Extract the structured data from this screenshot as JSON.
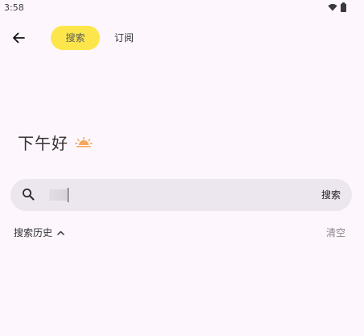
{
  "status_bar": {
    "time": "3:58",
    "icons": [
      "wifi-icon",
      "battery-icon"
    ]
  },
  "top_bar": {
    "back_icon": "arrow-back-icon",
    "tabs": [
      {
        "label": "搜索",
        "active": true
      },
      {
        "label": "订阅",
        "active": false
      }
    ]
  },
  "greeting": {
    "text": "下午好",
    "icon": "sun-icon"
  },
  "search": {
    "icon": "search-icon",
    "value": "",
    "submit_label": "搜索"
  },
  "history": {
    "title": "搜索历史",
    "toggle_icon": "chevron-up-icon",
    "clear_label": "清空"
  },
  "colors": {
    "background": "#fdf7fd",
    "accent": "#fde64b",
    "search_bar": "#ece6ee",
    "sun": "#f5a65b"
  }
}
